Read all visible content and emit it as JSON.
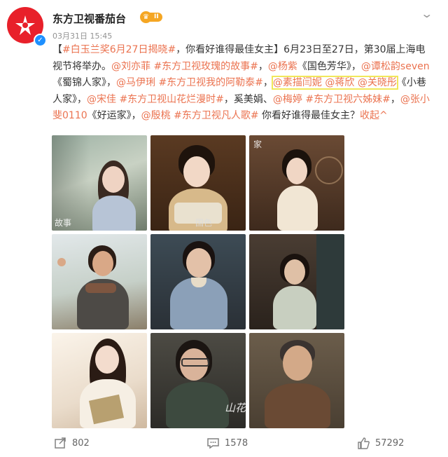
{
  "header": {
    "username": "东方卫视番茄台",
    "badge_level": "II",
    "timestamp": "03月31日 15:45"
  },
  "post": {
    "p01": "【",
    "p02": "#白玉兰奖6月27日揭晓#",
    "p03": "，你看好谁得最佳女主】6月23日至27日，第30届上海电视节将举办。",
    "p04": "@刘亦菲",
    "p05": " ",
    "p06": "#东方卫视玫瑰的故事#",
    "p07": "，",
    "p08": "@杨紫",
    "p09": "《国色芳华》，",
    "p10": "@谭松韵seven",
    "p11": "《蜀锦人家》，",
    "p12": "@马伊琍",
    "p13": " ",
    "p14": "#东方卫视我的阿勒泰#",
    "p15": "，",
    "p16": "@素描闫妮",
    "p17": " ",
    "p18": "@蒋欣",
    "p19": " ",
    "p20": "@关晓彤",
    "p21": "《小巷人家》，",
    "p22": "@宋佳",
    "p23": " ",
    "p24": "#东方卫视山花烂漫时#",
    "p25": "，奚美娟、",
    "p26": "@梅婷",
    "p27": " ",
    "p28": "#东方卫视六姊妹#",
    "p29": "，",
    "p30": "@张小斐0110",
    "p31": "《好运家》，",
    "p32": "@殷桃",
    "p33": " ",
    "p34": "#东方卫视凡人歌#",
    "p35": " 你看好谁得最佳女主？",
    "p36": "收起",
    "p37": "^"
  },
  "photos": {
    "p1_caption": "故事",
    "p2_caption": "国色",
    "p3_caption": "家",
    "p9_caption": "山花"
  },
  "footer": {
    "reposts": "802",
    "comments": "1578",
    "likes": "57292"
  },
  "colors": {
    "link": "#eb7350",
    "highlight_box": "#f1e75a",
    "brand_red": "#e8202a"
  }
}
